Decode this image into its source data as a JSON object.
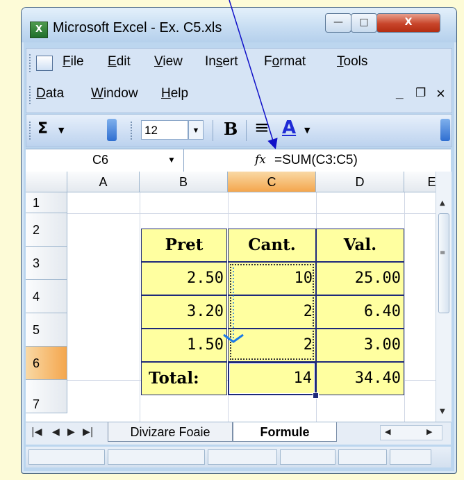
{
  "window": {
    "title": "Microsoft Excel - Ex. C5.xls",
    "app_icon": "excel-icon",
    "controls": {
      "minimize": "—",
      "maximize": "□",
      "close": "X"
    }
  },
  "menu": {
    "row1": [
      {
        "name": "file",
        "pre": "",
        "acc": "F",
        "post": "ile"
      },
      {
        "name": "edit",
        "pre": "",
        "acc": "E",
        "post": "dit"
      },
      {
        "name": "view",
        "pre": "",
        "acc": "V",
        "post": "iew"
      },
      {
        "name": "insert",
        "pre": "In",
        "acc": "s",
        "post": "ert"
      },
      {
        "name": "format",
        "pre": "F",
        "acc": "o",
        "post": "rmat"
      },
      {
        "name": "tools",
        "pre": "",
        "acc": "T",
        "post": "ools"
      }
    ],
    "row2": [
      {
        "name": "data",
        "pre": "",
        "acc": "D",
        "post": "ata"
      },
      {
        "name": "window",
        "pre": "",
        "acc": "W",
        "post": "indow"
      },
      {
        "name": "help",
        "pre": "",
        "acc": "H",
        "post": "elp"
      }
    ],
    "doc_controls": {
      "minimize": "_",
      "restore": "❐",
      "close": "×"
    }
  },
  "toolbar": {
    "autosum": "Σ",
    "font_size": "12",
    "bold": "B",
    "align": "≡",
    "font_color": "A",
    "font_color_hex": "#1f2bd6"
  },
  "formula_bar": {
    "name_box": "C6",
    "fx": "fx",
    "formula": "=SUM(C3:C5)"
  },
  "grid": {
    "columns": [
      "A",
      "B",
      "C",
      "D",
      "E"
    ],
    "selected_column": "C",
    "rows": [
      "1",
      "2",
      "3",
      "4",
      "5",
      "6",
      "7"
    ],
    "selected_row": "6",
    "headers": {
      "b": "Pret",
      "c": "Cant.",
      "d": "Val."
    },
    "data": [
      {
        "b": "2.50",
        "c": "10",
        "d": "25.00"
      },
      {
        "b": "3.20",
        "c": "2",
        "d": "6.40"
      },
      {
        "b": "1.50",
        "c": "2",
        "d": "3.00"
      }
    ],
    "total": {
      "label": "Total:",
      "c": "14",
      "d": "34.40"
    },
    "cell_fill": "#ffffa0"
  },
  "sheet_tabs": {
    "nav": [
      "|◀",
      "◀",
      "▶",
      "▶|"
    ],
    "tabs": [
      "Divizare Foaie",
      "Formule"
    ],
    "active": "Formule"
  },
  "colors": {
    "background": "#fdfbd7",
    "annotation_arrow": "#1010c8",
    "fill_arrow": "#1a7ae8"
  }
}
